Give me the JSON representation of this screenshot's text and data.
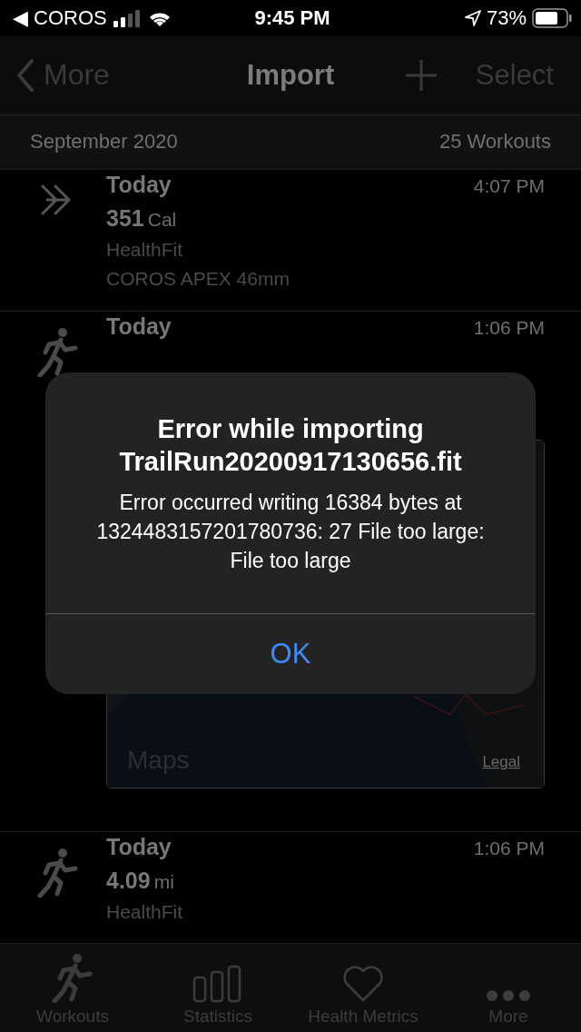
{
  "status_bar": {
    "back_app": "◀ COROS",
    "time": "9:45 PM",
    "battery": "73%"
  },
  "nav": {
    "back": "More",
    "title": "Import",
    "select": "Select"
  },
  "section": {
    "title": "September 2020",
    "count": "25 Workouts"
  },
  "workouts": [
    {
      "kind": "import",
      "title": "Today",
      "time": "4:07 PM",
      "value": "351",
      "unit": "Cal",
      "lines": [
        "HealthFit",
        "COROS APEX 46mm"
      ]
    },
    {
      "kind": "run",
      "title": "Today",
      "time": "1:06 PM",
      "map": {
        "attribution": "Maps",
        "legal": "Legal"
      }
    },
    {
      "kind": "run",
      "title": "Today",
      "time": "1:06 PM",
      "value": "4.09",
      "unit": "mi",
      "lines": [
        "HealthFit"
      ]
    }
  ],
  "alert": {
    "title": "Error while importing TrailRun20200917130656.fit",
    "message": "Error occurred writing 16384 bytes at 1324483157201780736: 27 File too large: File too large",
    "button": "OK"
  },
  "tabs": [
    {
      "kind": "run",
      "label": "Workouts",
      "selected": false
    },
    {
      "kind": "bars",
      "label": "Statistics",
      "selected": false
    },
    {
      "kind": "heart",
      "label": "Health Metrics",
      "selected": false
    },
    {
      "kind": "dots",
      "label": "More",
      "selected": false
    }
  ]
}
